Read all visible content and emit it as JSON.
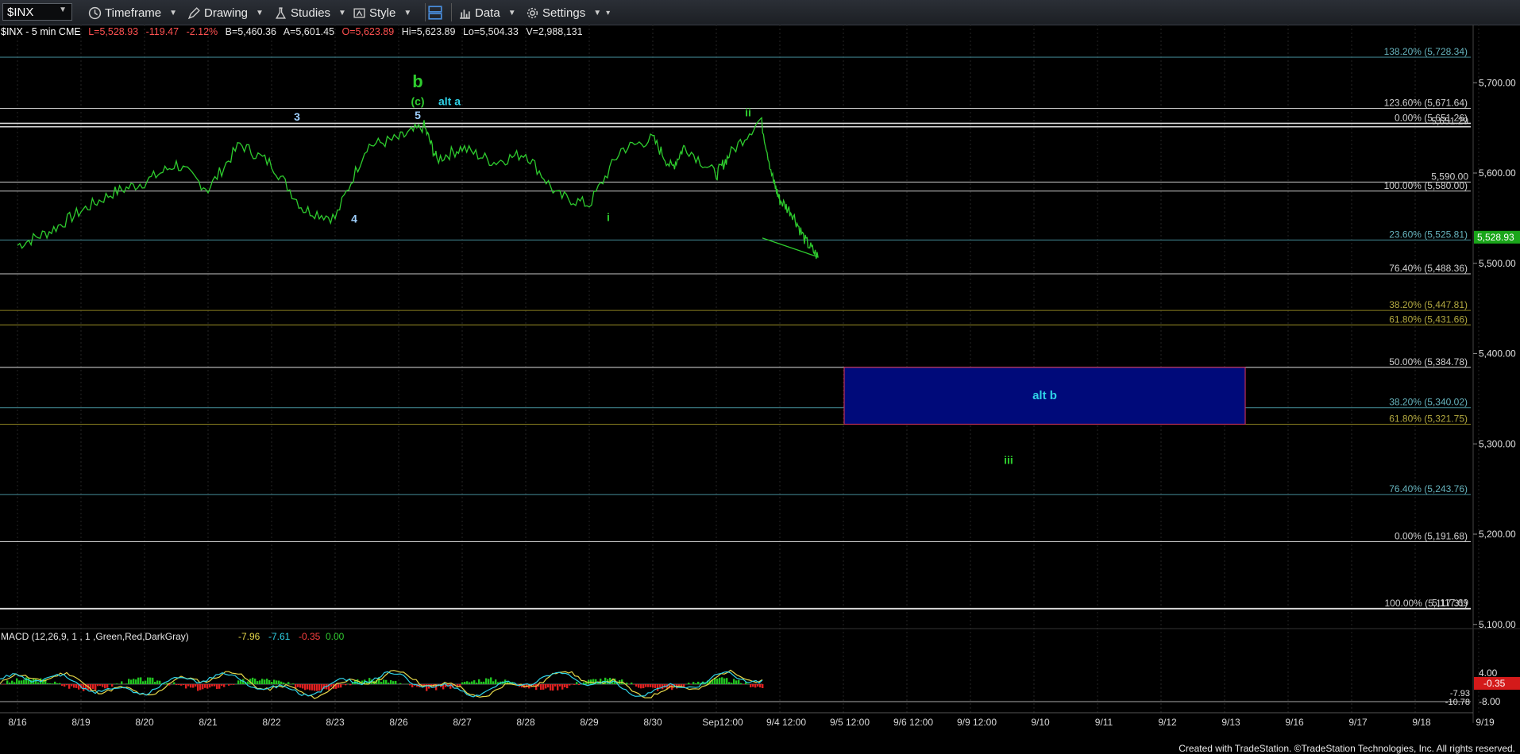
{
  "toolbar": {
    "symbol": "$INX",
    "timeframe_label": "Timeframe",
    "drawing_label": "Drawing",
    "studies_label": "Studies",
    "style_label": "Style",
    "data_label": "Data",
    "settings_label": "Settings"
  },
  "infobar": {
    "title": "$INX - 5 min  CME",
    "last": "L=5,528.93",
    "change": "-119.47",
    "pct": "-2.12%",
    "bid": "B=5,460.36",
    "ask": "A=5,601.45",
    "open": "O=5,623.89",
    "high": "Hi=5,623.89",
    "low": "Lo=5,504.33",
    "volume": "V=2,988,131"
  },
  "macd": {
    "label": "MACD (12,26,9, 1 , 1 ,Green,Red,DarkGray)",
    "v1": "-7.96",
    "v2": "-7.61",
    "v3": "-0.35",
    "v4": "0.00",
    "axis_ticks": [
      "4.00",
      "-8.00"
    ],
    "tags": [
      "-0.35",
      "-7.93",
      "-10.78"
    ]
  },
  "footer": "Created with TradeStation. ©TradeStation Technologies, Inc. All rights reserved.",
  "colors": {
    "green": "#2ecc2e",
    "cyan": "#2fd3e8",
    "rect": "#000a7a",
    "rect_border": "#c0305a"
  },
  "chart_data": {
    "type": "line",
    "ylim": [
      5085,
      5760
    ],
    "y_ticks": [
      5700,
      5600,
      5500,
      5400,
      5300,
      5200,
      5100
    ],
    "y_tick_labels": [
      "5,700.00",
      "5,600.00",
      "5,500.00",
      "5,400.00",
      "5,300.00",
      "5,200.00",
      "5,100.00"
    ],
    "last_price_tag": "5,528.93",
    "x_labels": [
      "8/16",
      "8/19",
      "8/20",
      "8/21",
      "8/22",
      "8/23",
      "8/26",
      "8/27",
      "8/28",
      "8/29",
      "8/30",
      "Sep12:00",
      "9/4 12:00",
      "9/5 12:00",
      "9/6 12:00",
      "9/9 12:00",
      "9/10",
      "9/11",
      "9/12",
      "9/13",
      "9/16",
      "9/17",
      "9/18",
      "9/19"
    ],
    "series": [
      {
        "x": [
          0,
          0.5,
          1,
          1.5,
          2,
          2.5,
          3,
          3.5,
          4,
          4.5,
          5,
          5.5,
          6,
          6.4,
          6.6,
          7,
          7.5,
          8,
          8.5,
          9,
          9.5,
          10,
          10.3,
          10.5,
          11,
          11.2,
          11.7,
          11.9,
          12,
          12.2,
          12.4,
          12.6
        ],
        "values": [
          5520,
          5535,
          5558,
          5578,
          5590,
          5610,
          5582,
          5632,
          5610,
          5560,
          5550,
          5630,
          5638,
          5652,
          5615,
          5628,
          5612,
          5622,
          5575,
          5565,
          5626,
          5638,
          5605,
          5630,
          5598,
          5620,
          5660,
          5590,
          5570,
          5555,
          5525,
          5507
        ]
      }
    ],
    "fib_lines": [
      {
        "label": "138.20% (5,728.34)",
        "price": 5728.34,
        "color": "#3d7e88"
      },
      {
        "label": "123.60% (5,671.64)",
        "price": 5671.64,
        "color": "#cfcfcf"
      },
      {
        "label": "0.00% (5,651.26)",
        "price": 5655,
        "color": "#d8d8d8"
      },
      {
        "label": "5,651.29",
        "price": 5651.29,
        "color": "#d8d8d8"
      },
      {
        "label": "5,590.00",
        "price": 5590,
        "color": "#c8c8c8"
      },
      {
        "label": "100.00% (5,580.00)",
        "price": 5580,
        "color": "#c8c8c8"
      },
      {
        "label": "23.60% (5,525.81)",
        "price": 5525.81,
        "color": "#3d7e88"
      },
      {
        "label": "76.40% (5,488.36)",
        "price": 5488.36,
        "color": "#c8c8c8"
      },
      {
        "label": "38.20% (5,447.81)",
        "price": 5447.81,
        "color": "#8a8020"
      },
      {
        "label": "61.80% (5,431.66)",
        "price": 5431.66,
        "color": "#8a8020"
      },
      {
        "label": "50.00% (5,384.78)",
        "price": 5384.78,
        "color": "#c8c8c8"
      },
      {
        "label": "38.20% (5,340.02)",
        "price": 5340.02,
        "color": "#3d7e88"
      },
      {
        "label": "61.80% (5,321.75)",
        "price": 5321.75,
        "color": "#8a8020"
      },
      {
        "label": "76.40% (5,243.76)",
        "price": 5243.76,
        "color": "#3d7e88"
      },
      {
        "label": "0.00% (5,191.68)",
        "price": 5191.68,
        "color": "#c8c8c8"
      },
      {
        "label": "100.00% (5,117.31)",
        "price": 5117.31,
        "color": "#d8d8d8"
      },
      {
        "label": "5,117.69",
        "price": 5117.69,
        "color": "#d8d8d8"
      }
    ],
    "box": {
      "label": "alt b",
      "x0": 14,
      "x1": 20.3,
      "price_top": 5384.78,
      "price_bottom": 5321.75
    },
    "annotations": [
      {
        "text": "3",
        "x": 4.4,
        "price": 5658,
        "color": "#9fd0ff"
      },
      {
        "text": "4",
        "x": 5.3,
        "price": 5545,
        "color": "#9fd0ff"
      },
      {
        "text": "5",
        "x": 6.3,
        "price": 5660,
        "color": "#9fd0ff"
      },
      {
        "text": "b",
        "x": 6.3,
        "price": 5695,
        "color": "#2ecc2e"
      },
      {
        "text": "(c)",
        "x": 6.3,
        "price": 5675,
        "color": "#2ecc2e"
      },
      {
        "text": "alt a",
        "x": 6.8,
        "price": 5675,
        "color": "#2fd3e8"
      },
      {
        "text": "ii",
        "x": 11.5,
        "price": 5663,
        "color": "#2ecc2e"
      },
      {
        "text": "i",
        "x": 9.3,
        "price": 5547,
        "color": "#2ecc2e"
      },
      {
        "text": "iii",
        "x": 15.6,
        "price": 5278,
        "color": "#2ecc2e"
      }
    ]
  }
}
